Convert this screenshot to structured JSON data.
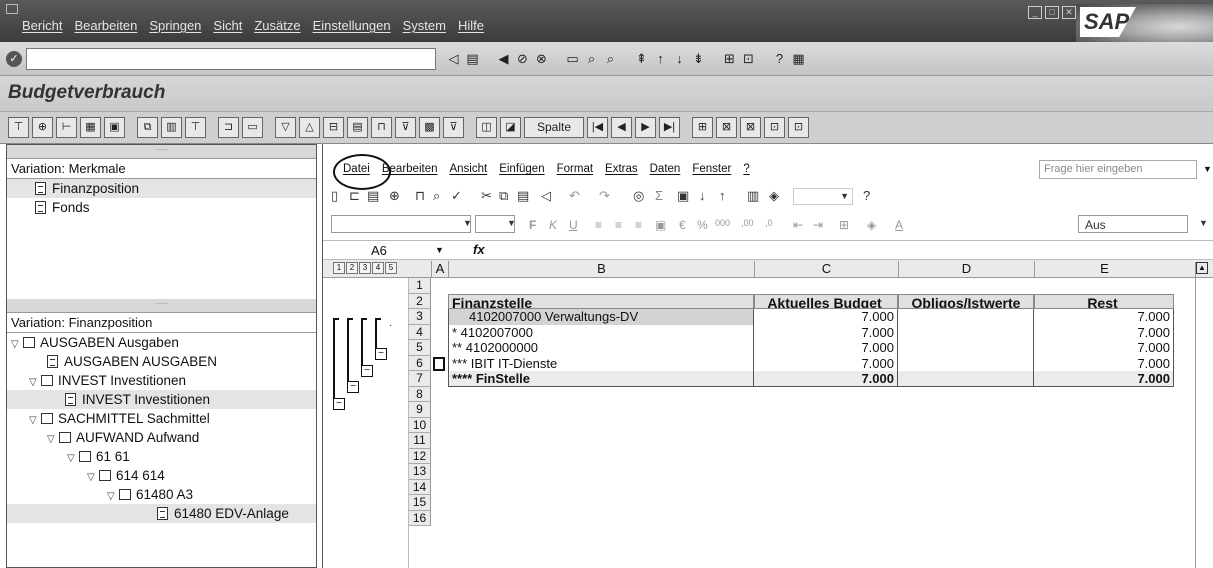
{
  "menubar": {
    "items": [
      "Bericht",
      "Bearbeiten",
      "Springen",
      "Sicht",
      "Zusätze",
      "Einstellungen",
      "System",
      "Hilfe"
    ],
    "logo": "SAP"
  },
  "screen": {
    "title": "Budgetverbrauch"
  },
  "nav": {
    "pane1_label": "Variation: Merkmale",
    "pane1_items": [
      "Finanzposition",
      "Fonds"
    ],
    "pane2_label": "Variation: Finanzposition",
    "tree": [
      "AUSGABEN Ausgaben",
      "AUSGABEN AUSGABEN",
      "INVEST Investitionen",
      "INVEST Investitionen",
      "SACHMITTEL Sachmittel",
      "AUFWAND Aufwand",
      "61 61",
      "614 614",
      "61480 A3",
      "61480 EDV-Anlage"
    ]
  },
  "sheet": {
    "menu": [
      "Datei",
      "Bearbeiten",
      "Ansicht",
      "Einfügen",
      "Format",
      "Extras",
      "Daten",
      "Fenster",
      "?"
    ],
    "ask_placeholder": "Frage hier eingeben",
    "zoom_label": "Aus",
    "cell_ref": "A6",
    "fx": "fx",
    "spalte_label": "Spalte",
    "level_buttons": [
      "1",
      "2",
      "3",
      "4",
      "5"
    ],
    "columns": [
      "A",
      "B",
      "C",
      "D",
      "E"
    ],
    "row_numbers": [
      "1",
      "2",
      "3",
      "4",
      "5",
      "6",
      "7",
      "8",
      "9",
      "10",
      "11",
      "12",
      "13",
      "14",
      "15",
      "16"
    ],
    "header": {
      "finanzstelle": "Finanzstelle",
      "budget": "Aktuelles Budget",
      "obligo": "Obligos/Istwerte",
      "rest": "Rest"
    },
    "rows": [
      {
        "name": "4102007000  Verwaltungs-DV",
        "budget": "7.000",
        "obligo": "",
        "rest": "7.000"
      },
      {
        "name": "*  4102007000",
        "budget": "7.000",
        "obligo": "",
        "rest": "7.000"
      },
      {
        "name": "**  4102000000",
        "budget": "7.000",
        "obligo": "",
        "rest": "7.000"
      },
      {
        "name": "***  IBIT IT-Dienste",
        "budget": "7.000",
        "obligo": "",
        "rest": "7.000"
      },
      {
        "name": "****  FinStelle",
        "budget": "7.000",
        "obligo": "",
        "rest": "7.000"
      }
    ]
  }
}
